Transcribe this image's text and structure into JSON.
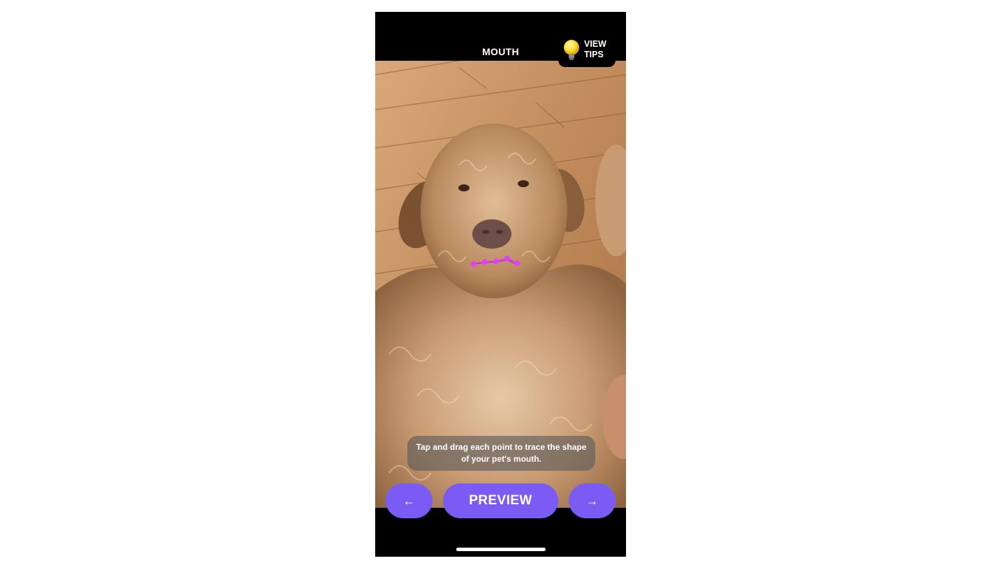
{
  "header": {
    "title": "MOUTH",
    "tips_label": "VIEW\nTIPS"
  },
  "photo": {
    "subject": "dog-photo",
    "trace_color": "#e040fb"
  },
  "instruction": {
    "text": "Tap and drag each point to trace the shape of your pet's mouth."
  },
  "controls": {
    "back_label": "←",
    "preview_label": "PREVIEW",
    "next_label": "→"
  },
  "colors": {
    "accent": "#7a5cf5",
    "background": "#000000"
  }
}
